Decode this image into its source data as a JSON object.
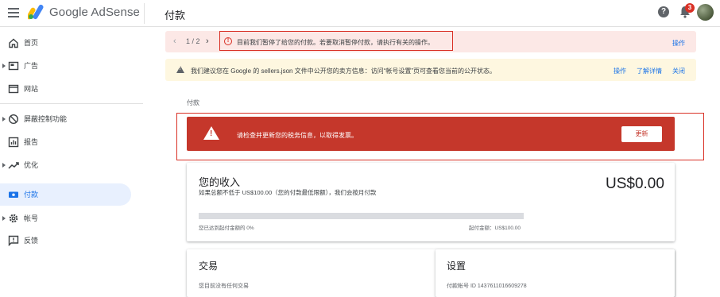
{
  "app": {
    "brand": "Google AdSense",
    "page_title": "付款",
    "notification_count": "3",
    "help_glyph": "?"
  },
  "sidebar": {
    "items": [
      {
        "label": "首页",
        "icon": "home-icon",
        "has_caret": false,
        "active": false
      },
      {
        "label": "广告",
        "icon": "ads-icon",
        "has_caret": true,
        "active": false
      },
      {
        "label": "网站",
        "icon": "sites-icon",
        "has_caret": false,
        "active": false
      },
      {
        "label": "屏蔽控制功能",
        "icon": "block-icon",
        "has_caret": true,
        "active": false
      },
      {
        "label": "报告",
        "icon": "reports-icon",
        "has_caret": false,
        "active": false
      },
      {
        "label": "优化",
        "icon": "optimize-icon",
        "has_caret": true,
        "active": false
      },
      {
        "label": "付款",
        "icon": "payments-icon",
        "has_caret": false,
        "active": true
      },
      {
        "label": "帐号",
        "icon": "gear-icon",
        "has_caret": true,
        "active": false
      },
      {
        "label": "反馈",
        "icon": "feedback-icon",
        "has_caret": false,
        "active": false
      }
    ]
  },
  "alerts": {
    "pager": "1 / 2",
    "pink_text": "目前我们暂停了给您的付款。若要取消暂停付款，请执行有关的操作。",
    "pink_action": "操作",
    "yellow_text": "我们建议您在 Google 的 sellers.json 文件中公开您的卖方信息：访问“帐号设置”页可查看您当前的公开状态。",
    "yellow_actions": [
      "操作",
      "了解详情",
      "关闭"
    ]
  },
  "breadcrumb": "付款",
  "tax_banner": {
    "text": "请检查并更新您的税务信息，以取得发票。",
    "button": "更新"
  },
  "earnings": {
    "title": "您的收入",
    "subtitle": "如果总额不低于 US$100.00（您的付款最低限额），我们会按月付款",
    "amount": "US$0.00",
    "progress_fraction": 0.0,
    "progress_left": "您已达到起付金额的 0%",
    "progress_right": "起付金额：US$100.00"
  },
  "transactions": {
    "title": "交易",
    "partial": "您目前没有任何交易"
  },
  "settings": {
    "title": "设置",
    "partial": "付款帐号 ID 1437611016609278"
  },
  "colors": {
    "accent": "#1a73e8",
    "error": "#d93025",
    "banner_red": "#c5372b",
    "pink_bg": "#fce8e6",
    "yellow_bg": "#fef7e0"
  }
}
